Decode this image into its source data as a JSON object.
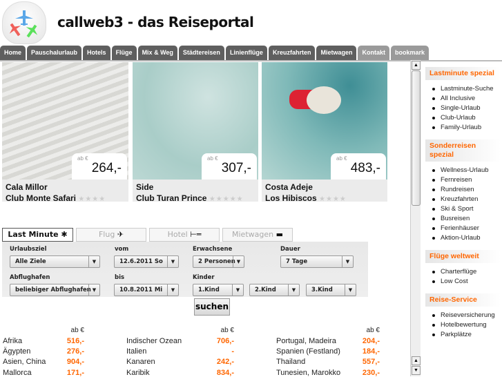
{
  "header": {
    "title": "callweb3 - das Reiseportal"
  },
  "nav": [
    {
      "label": "Home"
    },
    {
      "label": "Pauschalurlaub"
    },
    {
      "label": "Hotels"
    },
    {
      "label": "Flüge"
    },
    {
      "label": "Mix & Weg"
    },
    {
      "label": "Städtereisen"
    },
    {
      "label": "Linienflüge"
    },
    {
      "label": "Kreuzfahrten"
    },
    {
      "label": "Mietwagen"
    },
    {
      "label": "Kontakt"
    },
    {
      "label": "bookmark"
    }
  ],
  "offers": [
    {
      "ab": "ab €",
      "price": "264,-",
      "place": "Cala Millor",
      "hotel": "Club Monte Safari",
      "stars": "★★★★"
    },
    {
      "ab": "ab €",
      "price": "307,-",
      "place": "Side",
      "hotel": "Club Turan Prince",
      "stars": "★★★★★"
    },
    {
      "ab": "ab €",
      "price": "483,-",
      "place": "Costa Adeje",
      "hotel": "Los Hibiscos",
      "stars": "★★★★"
    }
  ],
  "search": {
    "tabs": [
      {
        "label": "Last Minute"
      },
      {
        "label": "Flug"
      },
      {
        "label": "Hotel"
      },
      {
        "label": "Mietwagen"
      }
    ],
    "urlaubsziel": {
      "label": "Urlaubsziel",
      "value": "Alle Ziele"
    },
    "vom": {
      "label": "vom",
      "value": "12.6.2011 So"
    },
    "erwachsene": {
      "label": "Erwachsene",
      "value": "2 Personen"
    },
    "dauer": {
      "label": "Dauer",
      "value": "7 Tage"
    },
    "abflughafen": {
      "label": "Abflughafen",
      "value": "beliebiger Abflughafen"
    },
    "bis": {
      "label": "bis",
      "value": "10.8.2011 Mi"
    },
    "kinder": {
      "label": "Kinder",
      "k1": "1.Kind",
      "k2": "2.Kind",
      "k3": "3.Kind"
    },
    "submit": "suchen"
  },
  "prices": {
    "header": "ab €",
    "col1": [
      {
        "name": "Afrika",
        "price": "516,-"
      },
      {
        "name": "Ägypten",
        "price": "276,-"
      },
      {
        "name": "Asien, China",
        "price": "904,-"
      },
      {
        "name": "Mallorca",
        "price": "171,-"
      }
    ],
    "col2": [
      {
        "name": "Indischer Ozean",
        "price": "706,-"
      },
      {
        "name": "Italien",
        "price": "-"
      },
      {
        "name": "Kanaren",
        "price": "242,-"
      },
      {
        "name": "Karibik",
        "price": "834,-"
      }
    ],
    "col3": [
      {
        "name": "Portugal, Madeira",
        "price": "204,-"
      },
      {
        "name": "Spanien (Festland)",
        "price": "184,-"
      },
      {
        "name": "Thailand",
        "price": "557,-"
      },
      {
        "name": "Tunesien, Marokko",
        "price": "230,-"
      }
    ]
  },
  "sidebar": {
    "sections": [
      {
        "title": "Lastminute spezial",
        "items": [
          "Lastminute-Suche",
          "All Inclusive",
          "Single-Urlaub",
          "Club-Urlaub",
          "Family-Urlaub"
        ]
      },
      {
        "title": "Sonderreisen spezial",
        "items": [
          "Wellness-Urlaub",
          "Fernreisen",
          "Rundreisen",
          "Kreuzfahrten",
          "Ski & Sport",
          "Busreisen",
          "Ferienhäuser",
          "Aktion-Urlaub"
        ]
      },
      {
        "title": "Flüge weltweit",
        "items": [
          "Charterflüge",
          "Low Cost"
        ]
      },
      {
        "title": "Reise-Service",
        "items": [
          "Reiseversicherung",
          "Hotelbewertung",
          "Parkplätze"
        ]
      }
    ]
  },
  "colors": {
    "accent": "#ff6600",
    "nav": "#5f5f5f"
  }
}
